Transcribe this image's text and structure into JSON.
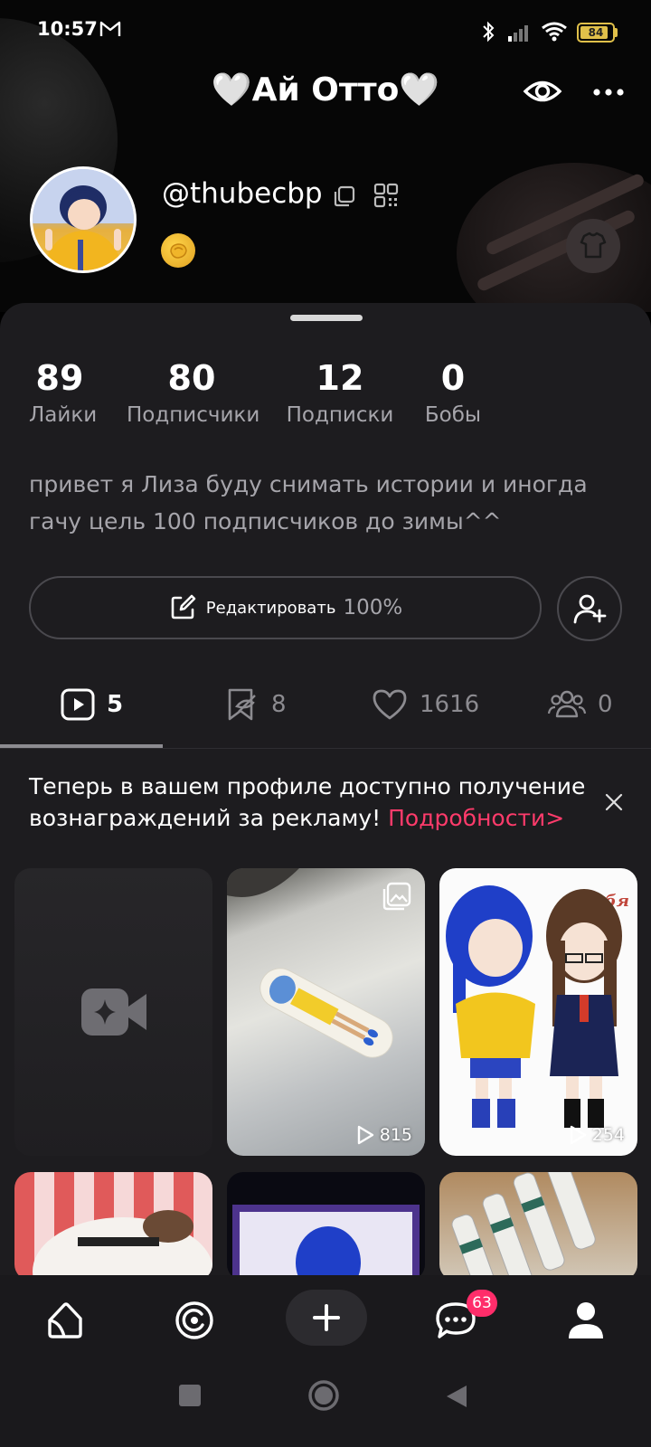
{
  "status_bar": {
    "time": "10:57",
    "battery": "84",
    "icons": [
      "gmail-icon",
      "bluetooth-icon",
      "signal-icon",
      "wifi-icon",
      "battery-icon"
    ]
  },
  "header": {
    "title": "🤍Ай Отто🤍",
    "username": "@thubecbp"
  },
  "stats": [
    {
      "value": "89",
      "label": "Лайки"
    },
    {
      "value": "80",
      "label": "Подписчики"
    },
    {
      "value": "12",
      "label": "Подписки"
    },
    {
      "value": "0",
      "label": "Бобы"
    }
  ],
  "bio": "привет я Лиза буду снимать истории и иногда гачу  цель 100 подписчиков до зимы^^",
  "edit_profile": {
    "label": "Редактировать",
    "progress": "100%"
  },
  "tabs": [
    {
      "icon": "play-icon",
      "count": "5"
    },
    {
      "icon": "bookmark-icon",
      "count": "8"
    },
    {
      "icon": "heart-icon",
      "count": "1616"
    },
    {
      "icon": "people-icon",
      "count": "0"
    }
  ],
  "promo": {
    "text": "Теперь в вашем профиле доступно получение вознаграждений за рекламу! ",
    "link": "Подробности>"
  },
  "videos": [
    {
      "views": "815"
    },
    {
      "views": "254"
    }
  ],
  "tile3_caption": "я тебя",
  "nav": {
    "messages_badge": "63"
  },
  "colors": {
    "accent": "#ff2d6a",
    "link": "#ff3b6b",
    "sheet_bg": "#1d1c1f",
    "muted_text": "#a6a5ab"
  }
}
